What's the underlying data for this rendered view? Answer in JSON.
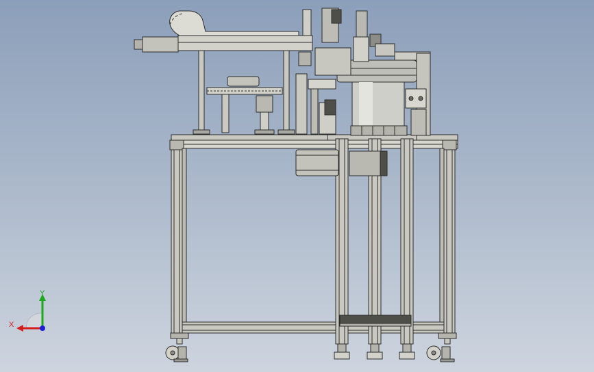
{
  "viewport": {
    "background_top": "#8c9fba",
    "background_bottom": "#cdd4de"
  },
  "model": {
    "metal_color": "#c9c9c2",
    "edge_color": "#2b2b2b",
    "bowl_color": "#bfbfba"
  },
  "triad": {
    "x_label": "X",
    "y_label": "Y",
    "x_color": "#d41e1e",
    "y_color": "#1ea81e",
    "z_color": "#1e1ed4"
  }
}
